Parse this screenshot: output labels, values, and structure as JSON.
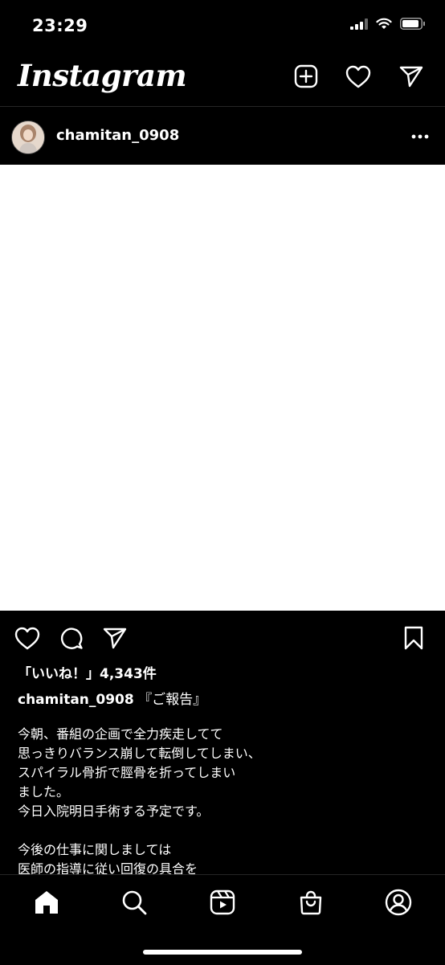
{
  "status_bar": {
    "time": "23:29"
  },
  "header": {
    "logo": "Instagram",
    "icons": [
      "add-post-icon",
      "activity-heart-icon",
      "direct-message-icon"
    ]
  },
  "post": {
    "username": "chamitan_0908",
    "likes": "「いいね！」4,343件",
    "caption_user": "chamitan_0908",
    "caption_title": "『ご報告』",
    "caption_body": "今朝、番組の企画で全力疾走してて\n思っきりバランス崩して転倒してしまい、\nスパイラル骨折で脛骨を折ってしまい\nました。\n今日入院明日手術する予定です。\n\n今後の仕事に関しましては\n医師の指導に従い回復の具合を"
  },
  "nav": {
    "items": [
      "home-icon",
      "search-icon",
      "reels-icon",
      "shop-icon",
      "profile-icon"
    ]
  },
  "colors": {
    "background": "#000000",
    "text": "#ffffff",
    "divider": "#262626",
    "image_placeholder": "#ffffff"
  }
}
